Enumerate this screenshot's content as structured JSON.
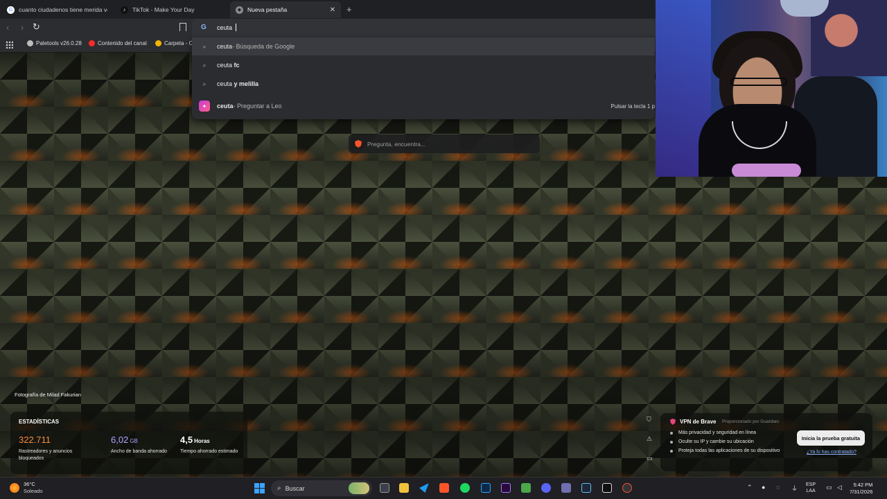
{
  "tabs": [
    {
      "title": "cuanto ciudadenos tiene merida vene",
      "active": false
    },
    {
      "title": "TikTok - Make Your Day",
      "active": false
    },
    {
      "title": "Nueva pestaña",
      "active": true
    }
  ],
  "omnibox": {
    "value": "ceuta "
  },
  "bookmarks": [
    {
      "label": "Paletools v26.0.28"
    },
    {
      "label": "Contenido del canal"
    },
    {
      "label": "Carpeta - C"
    }
  ],
  "suggestions": [
    {
      "query": "ceuta",
      "suffix": " - Búsqueda de Google",
      "bold": "",
      "icon": "search-icon"
    },
    {
      "query": "ceuta ",
      "suffix": "",
      "bold": "fc",
      "icon": "search-icon"
    },
    {
      "query": "ceuta ",
      "suffix": "",
      "bold": "y melilla",
      "icon": "search-icon"
    },
    {
      "query": "ceuta",
      "suffix": " - Preguntar a Leo",
      "bold": "",
      "icon": "leo-icon",
      "hint": "Pulsar la tecla 1 p"
    }
  ],
  "ask_placeholder": "Pregunta, encuentra...",
  "photo_credit": "Fotografía de Milad Fakurian",
  "stats": {
    "title": "ESTADÍSTICAS",
    "items": [
      {
        "value": "322.711",
        "unit": "",
        "desc": "Rastreadores y anuncios bloqueados",
        "color": "#fb8c3a"
      },
      {
        "value": "6,02",
        "unit": "GB",
        "desc": "Ancho de banda ahorrado",
        "color": "#a9a2ff"
      },
      {
        "value": "4,5",
        "unit": "Horas",
        "desc": "Tiempo ahorrado estimado",
        "color": "#ffffff"
      }
    ]
  },
  "vpn": {
    "title": "VPN de Brave",
    "provider": "Proporcionado por Guardian",
    "features": [
      "Más privacidad y seguridad en línea",
      "Oculte su IP y cambie su ubicación",
      "Proteja todas las aplicaciones de su dispositivo"
    ],
    "trial_button": "Inicia la prueba gratuita",
    "have_link": "¿Ya lo has contratado?"
  },
  "taskbar": {
    "weather_temp": "36°C",
    "weather_desc": "Soleado",
    "search_label": "Buscar",
    "lang_line1": "ESP",
    "lang_line2": "LAA",
    "time": "5:42 PM",
    "date": "7/31/2026"
  },
  "colors": {
    "accent": "#3ba3ff",
    "brave": "#fb542b",
    "leo": "#c53dd8"
  }
}
